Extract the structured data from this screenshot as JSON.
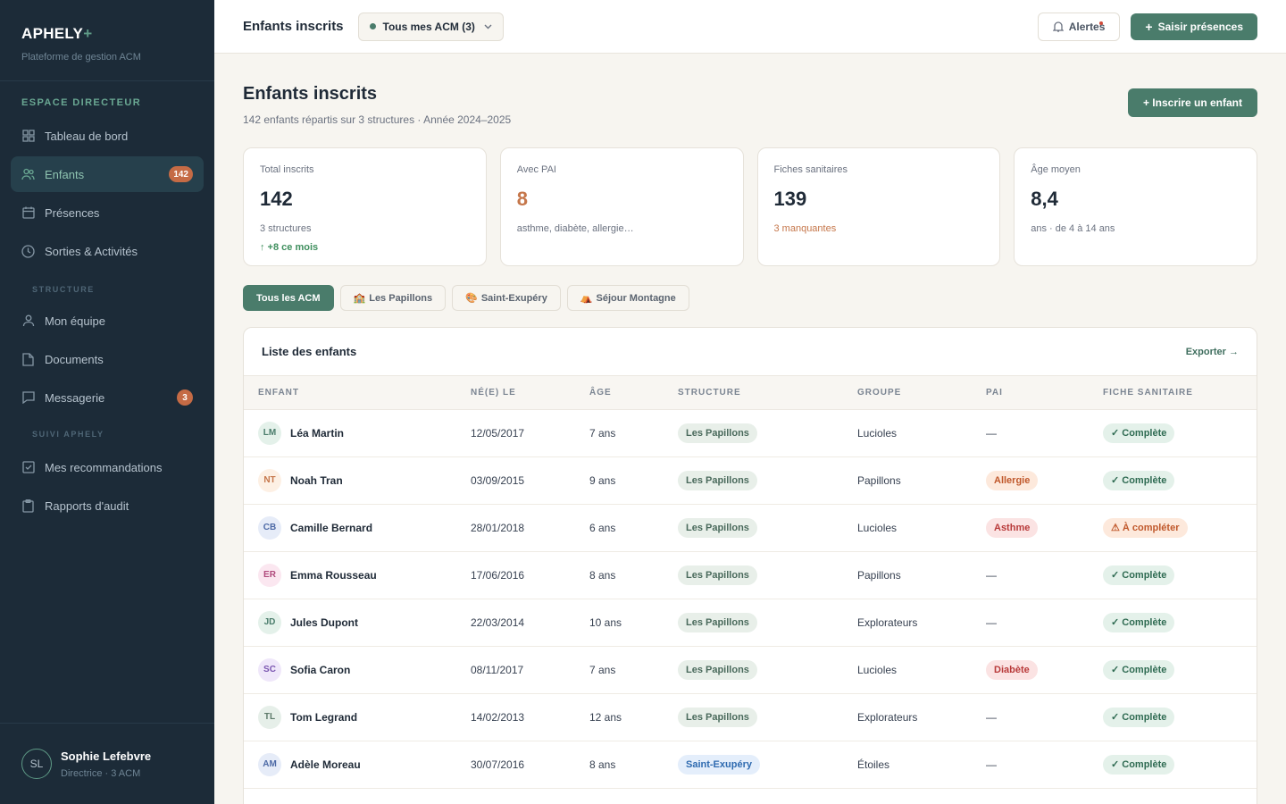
{
  "brand": {
    "name": "APHELY",
    "plus": "+",
    "subtitle": "Plateforme de gestion ACM"
  },
  "sidebar": {
    "section_title": "ESPACE DIRECTEUR",
    "items": [
      {
        "label": "Tableau de bord",
        "icon": "grid-icon",
        "active": false,
        "badge": ""
      },
      {
        "label": "Enfants",
        "icon": "users-icon",
        "active": true,
        "badge": "142"
      },
      {
        "label": "Présences",
        "icon": "calendar-icon",
        "active": false,
        "badge": ""
      },
      {
        "label": "Sorties & Activités",
        "icon": "clock-icon",
        "active": false,
        "badge": ""
      }
    ],
    "structure_title": "STRUCTURE",
    "structure_items": [
      {
        "label": "Mon équipe",
        "icon": "user-icon",
        "badge": ""
      },
      {
        "label": "Documents",
        "icon": "document-icon",
        "badge": ""
      },
      {
        "label": "Messagerie",
        "icon": "message-icon",
        "badge": "3"
      }
    ],
    "suivi_title": "SUIVI APHELY",
    "suivi_items": [
      {
        "label": "Mes recommandations",
        "icon": "checkbox-icon"
      },
      {
        "label": "Rapports d'audit",
        "icon": "clipboard-icon"
      }
    ],
    "user": {
      "initials": "SL",
      "name": "Sophie Lefebvre",
      "role": "Directrice · 3 ACM"
    }
  },
  "topbar": {
    "title": "Enfants inscrits",
    "acm_selector": "Tous mes ACM (3)",
    "alerts_label": "Alertes",
    "primary_label": "Saisir présences"
  },
  "page": {
    "title": "Enfants inscrits",
    "subtitle": "142 enfants répartis sur 3 structures · Année 2024–2025",
    "add_label": "+ Inscrire un enfant"
  },
  "stats": [
    {
      "label": "Total inscrits",
      "value": "142",
      "detail": "3 structures",
      "trend": "↑ +8 ce mois",
      "tone": "default"
    },
    {
      "label": "Avec PAI",
      "value": "8",
      "detail": "asthme, diabète, allergie…",
      "trend": "",
      "tone": "orange"
    },
    {
      "label": "Fiches sanitaires",
      "value": "139",
      "detail": "3 manquantes",
      "trend": "",
      "tone": "warn"
    },
    {
      "label": "Âge moyen",
      "value": "8,4",
      "detail": "ans · de 4 à 14 ans",
      "trend": "",
      "tone": "default"
    }
  ],
  "filters": [
    {
      "label": "Tous les ACM",
      "emoji": "",
      "active": true
    },
    {
      "label": "Les Papillons",
      "emoji": "🏫",
      "active": false
    },
    {
      "label": "Saint-Exupéry",
      "emoji": "🎨",
      "active": false
    },
    {
      "label": "Séjour Montagne",
      "emoji": "⛺",
      "active": false
    }
  ],
  "list": {
    "title": "Liste des enfants",
    "export_label": "Exporter →",
    "columns": [
      "ENFANT",
      "NÉ(E) LE",
      "ÂGE",
      "STRUCTURE",
      "GROUPE",
      "PAI",
      "FICHE SANITAIRE"
    ],
    "rows": [
      {
        "initials": "LM",
        "avatar_bg": "#e4f1ea",
        "avatar_fg": "#4a7c6b",
        "name": "Léa Martin",
        "born": "12/05/2017",
        "age": "7 ans",
        "structure": "Les Papillons",
        "group": "Lucioles",
        "pai": "—",
        "fiche": "✓ Complète"
      },
      {
        "initials": "NT",
        "avatar_bg": "#fdf0e4",
        "avatar_fg": "#c5764a",
        "name": "Noah Tran",
        "born": "03/09/2015",
        "age": "9 ans",
        "structure": "Les Papillons",
        "group": "Papillons",
        "pai": "Allergie",
        "fiche": "✓ Complète"
      },
      {
        "initials": "CB",
        "avatar_bg": "#e6ecf8",
        "avatar_fg": "#4d6aa6",
        "name": "Camille Bernard",
        "born": "28/01/2018",
        "age": "6 ans",
        "structure": "Les Papillons",
        "group": "Lucioles",
        "pai": "Asthme",
        "fiche": "⚠ À compléter"
      },
      {
        "initials": "ER",
        "avatar_bg": "#fbe7f0",
        "avatar_fg": "#b04a7c",
        "name": "Emma Rousseau",
        "born": "17/06/2016",
        "age": "8 ans",
        "structure": "Les Papillons",
        "group": "Papillons",
        "pai": "—",
        "fiche": "✓ Complète"
      },
      {
        "initials": "JD",
        "avatar_bg": "#e4f1ea",
        "avatar_fg": "#4a7c6b",
        "name": "Jules Dupont",
        "born": "22/03/2014",
        "age": "10 ans",
        "structure": "Les Papillons",
        "group": "Explorateurs",
        "pai": "—",
        "fiche": "✓ Complète"
      },
      {
        "initials": "SC",
        "avatar_bg": "#efe7fa",
        "avatar_fg": "#7a55b0",
        "name": "Sofia Caron",
        "born": "08/11/2017",
        "age": "7 ans",
        "structure": "Les Papillons",
        "group": "Lucioles",
        "pai": "Diabète",
        "fiche": "✓ Complète"
      },
      {
        "initials": "TL",
        "avatar_bg": "#e6efe9",
        "avatar_fg": "#5d7a6a",
        "name": "Tom Legrand",
        "born": "14/02/2013",
        "age": "12 ans",
        "structure": "Les Papillons",
        "group": "Explorateurs",
        "pai": "—",
        "fiche": "✓ Complète"
      },
      {
        "initials": "AM",
        "avatar_bg": "#e6ecf8",
        "avatar_fg": "#4d6aa6",
        "name": "Adèle Moreau",
        "born": "30/07/2016",
        "age": "8 ans",
        "structure": "Saint-Exupéry",
        "group": "Étoiles",
        "pai": "—",
        "fiche": "✓ Complète"
      }
    ]
  },
  "colors": {
    "sidebar_bg": "#1c2b38",
    "accent": "#4a7c6b",
    "badge": "#c56b45",
    "pill_papillons_bg": "#e8efe9",
    "pill_papillons_fg": "#4a6a5c",
    "pill_exupery_bg": "#e4eefb",
    "pill_exupery_fg": "#2f6bb0",
    "pai_allergie_bg": "#fde9dc",
    "pai_allergie_fg": "#c0582b",
    "pai_red_bg": "#fbe3e3",
    "pai_red_fg": "#b83a3a",
    "fiche_ok_bg": "#e4f1ea",
    "fiche_ok_fg": "#2f6b52",
    "fiche_warn_bg": "#fde9dc",
    "fiche_warn_fg": "#c0582b"
  }
}
